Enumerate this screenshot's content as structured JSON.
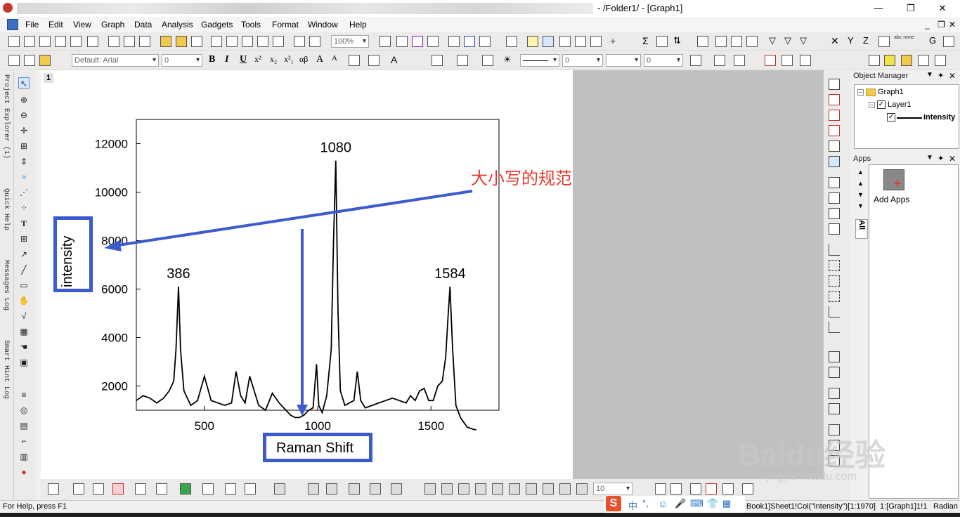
{
  "window": {
    "title": "- /Folder1/ - [Graph1]",
    "controls": [
      "—",
      "❐",
      "✕"
    ]
  },
  "menu": [
    "File",
    "Edit",
    "View",
    "Graph",
    "Data",
    "Analysis",
    "Gadgets",
    "Tools",
    "Format",
    "Window",
    "Help"
  ],
  "mdi_controls": [
    "_",
    "❐",
    "✕"
  ],
  "toolbar": {
    "zoom": "100%",
    "font": "Default: Arial",
    "font_size": "0",
    "line_width": "0",
    "fill_size": "0",
    "bold": "B",
    "italic": "I",
    "underline": "U",
    "symbol_glyphs": [
      "x²",
      "x₂",
      "x²₁",
      "αβ",
      "A",
      "A"
    ]
  },
  "left_dock": {
    "tabs": [
      "Project Explorer (1)",
      "Quick Help",
      "Messages Log",
      "Smart Hint Log"
    ]
  },
  "graph": {
    "layer_number": "1"
  },
  "chart_data": {
    "type": "line",
    "series": [
      {
        "name": "intensity",
        "x": [
          200,
          230,
          260,
          290,
          320,
          345,
          365,
          375,
          386,
          395,
          410,
          440,
          470,
          500,
          530,
          560,
          590,
          620,
          640,
          660,
          680,
          700,
          740,
          770,
          800,
          830,
          860,
          880,
          900,
          920,
          940,
          960,
          980,
          995,
          1005,
          1020,
          1040,
          1060,
          1070,
          1080,
          1090,
          1100,
          1120,
          1140,
          1160,
          1175,
          1190,
          1210,
          1240,
          1270,
          1300,
          1330,
          1360,
          1390,
          1410,
          1430,
          1450,
          1470,
          1490,
          1510,
          1530,
          1550,
          1565,
          1575,
          1584,
          1595,
          1610,
          1630,
          1660,
          1690,
          1700
        ],
        "values": [
          1400,
          1600,
          1500,
          1300,
          1500,
          1800,
          2200,
          3500,
          6100,
          3500,
          1800,
          1200,
          1400,
          2400,
          1400,
          1300,
          1200,
          1300,
          2600,
          1600,
          1300,
          2400,
          1200,
          1000,
          1700,
          1300,
          1000,
          800,
          700,
          700,
          800,
          1000,
          1100,
          2900,
          1200,
          900,
          1600,
          3500,
          8000,
          11300,
          5000,
          1800,
          1200,
          1300,
          1400,
          2600,
          1400,
          1100,
          1200,
          1300,
          1400,
          1500,
          1400,
          1300,
          1600,
          1400,
          1800,
          1900,
          1400,
          1400,
          2000,
          2200,
          3200,
          4800,
          6100,
          3600,
          1200,
          700,
          300,
          200,
          200
        ]
      }
    ],
    "xlim": [
      200,
      1800
    ],
    "ylim": [
      1000,
      13000
    ],
    "xticks": [
      500,
      1000,
      1500
    ],
    "yticks": [
      2000,
      4000,
      6000,
      8000,
      10000,
      12000
    ],
    "xtick_labels": [
      "500",
      "1000",
      "1500"
    ],
    "ytick_labels": [
      "2000",
      "4000",
      "6000",
      "8000",
      "10000",
      "12000"
    ],
    "xlabel": "Raman Shift",
    "ylabel": "intensity",
    "peak_labels": [
      "386",
      "1080",
      "1584"
    ],
    "peaks_x": [
      386,
      1080,
      1584
    ],
    "peaks_y": [
      6100,
      11300,
      6100
    ],
    "annotation": "大小写的规范",
    "colors": {
      "line": "#000000",
      "annotation_box": "#3b5bcf",
      "annotation_text": "#e03c2e",
      "arrow": "#3b5bcf"
    }
  },
  "object_manager": {
    "title": "Object Manager",
    "tree": {
      "graph": "Graph1",
      "layer": "Layer1",
      "plot": "intensity"
    }
  },
  "apps_panel": {
    "title": "Apps",
    "tab": "All",
    "item": "Add Apps"
  },
  "bottom_toolbar": {
    "size_value": "10"
  },
  "status": {
    "help": "For Help, press F1",
    "source": "Book1]Sheet1!Col(\"intensity\")[1:1970]",
    "layer": "1:[Graph1]1!1",
    "angle": "Radian",
    "ime_label": "中"
  },
  "watermark": {
    "logo": "Baidu经验",
    "url": "jingyan.baidu.com"
  }
}
